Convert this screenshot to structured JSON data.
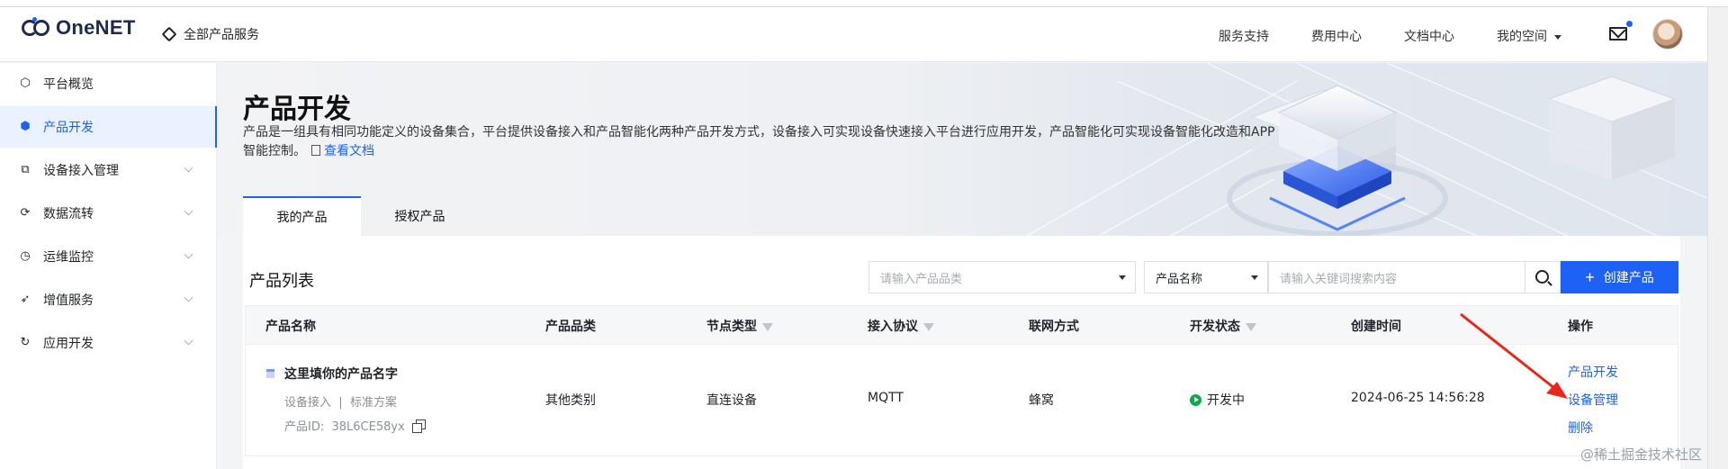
{
  "header": {
    "logo_text": "OneNET",
    "all_products": "全部产品服务",
    "nav": [
      "服务支持",
      "费用中心",
      "文档中心",
      "我的空间"
    ]
  },
  "sidebar": {
    "items": [
      {
        "label": "平台概览",
        "icon": "overview-icon",
        "active": false,
        "expandable": false
      },
      {
        "label": "产品开发",
        "icon": "cube-icon",
        "active": true,
        "expandable": false
      },
      {
        "label": "设备接入管理",
        "icon": "device-icon",
        "active": false,
        "expandable": true
      },
      {
        "label": "数据流转",
        "icon": "flow-icon",
        "active": false,
        "expandable": true
      },
      {
        "label": "运维监控",
        "icon": "monitor-icon",
        "active": false,
        "expandable": true
      },
      {
        "label": "增值服务",
        "icon": "send-icon",
        "active": false,
        "expandable": true
      },
      {
        "label": "应用开发",
        "icon": "app-icon",
        "active": false,
        "expandable": true
      }
    ]
  },
  "banner": {
    "title": "产品开发",
    "description": "产品是一组具有相同功能定义的设备集合，平台提供设备接入和产品智能化两种产品开发方式，设备接入可实现设备快速接入平台进行应用开发，产品智能化可实现设备智能化改造和APP智能控制。",
    "doc_link": "查看文档"
  },
  "tabs": [
    "我的产品",
    "授权产品"
  ],
  "list": {
    "title": "产品列表",
    "category_placeholder": "请输入产品品类",
    "search_field": "产品名称",
    "keyword_placeholder": "请输入关键词搜索内容",
    "create_label": "创建产品",
    "columns": [
      "产品名称",
      "产品品类",
      "节点类型",
      "接入协议",
      "联网方式",
      "开发状态",
      "创建时间",
      "操作"
    ],
    "rows": [
      {
        "name": "这里填你的产品名字",
        "access": "设备接入",
        "separator": "|",
        "scheme": "标准方案",
        "id_label": "产品ID:",
        "id": "38L6CE58yx",
        "category": "其他类别",
        "node_type": "直连设备",
        "protocol": "MQTT",
        "network": "蜂窝",
        "status": "开发中",
        "created": "2024-06-25 14:56:28",
        "actions": [
          "产品开发",
          "设备管理",
          "删除"
        ]
      }
    ]
  },
  "watermark": "@稀土掘金技术社区",
  "colors": {
    "accent": "#1d62f5",
    "status_green": "#11a64f",
    "annotation_arrow": "#e8271b"
  }
}
